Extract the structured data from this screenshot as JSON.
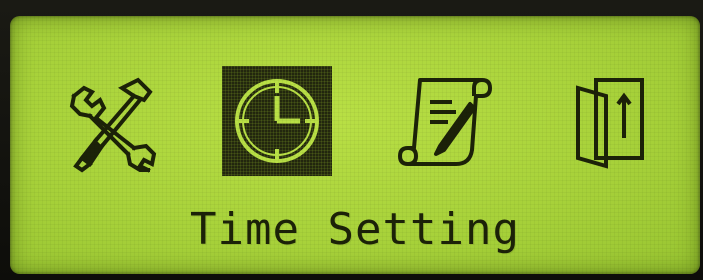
{
  "lcd": {
    "background_color": "#a8d23a",
    "pixel_color": "#1c2208",
    "selected_index": 1
  },
  "menu": {
    "items": [
      {
        "icon": "tools-icon",
        "selected": false
      },
      {
        "icon": "clock-icon",
        "selected": true
      },
      {
        "icon": "document-icon",
        "selected": false
      },
      {
        "icon": "exit-door-icon",
        "selected": false
      }
    ],
    "current_label": "Time Setting"
  }
}
